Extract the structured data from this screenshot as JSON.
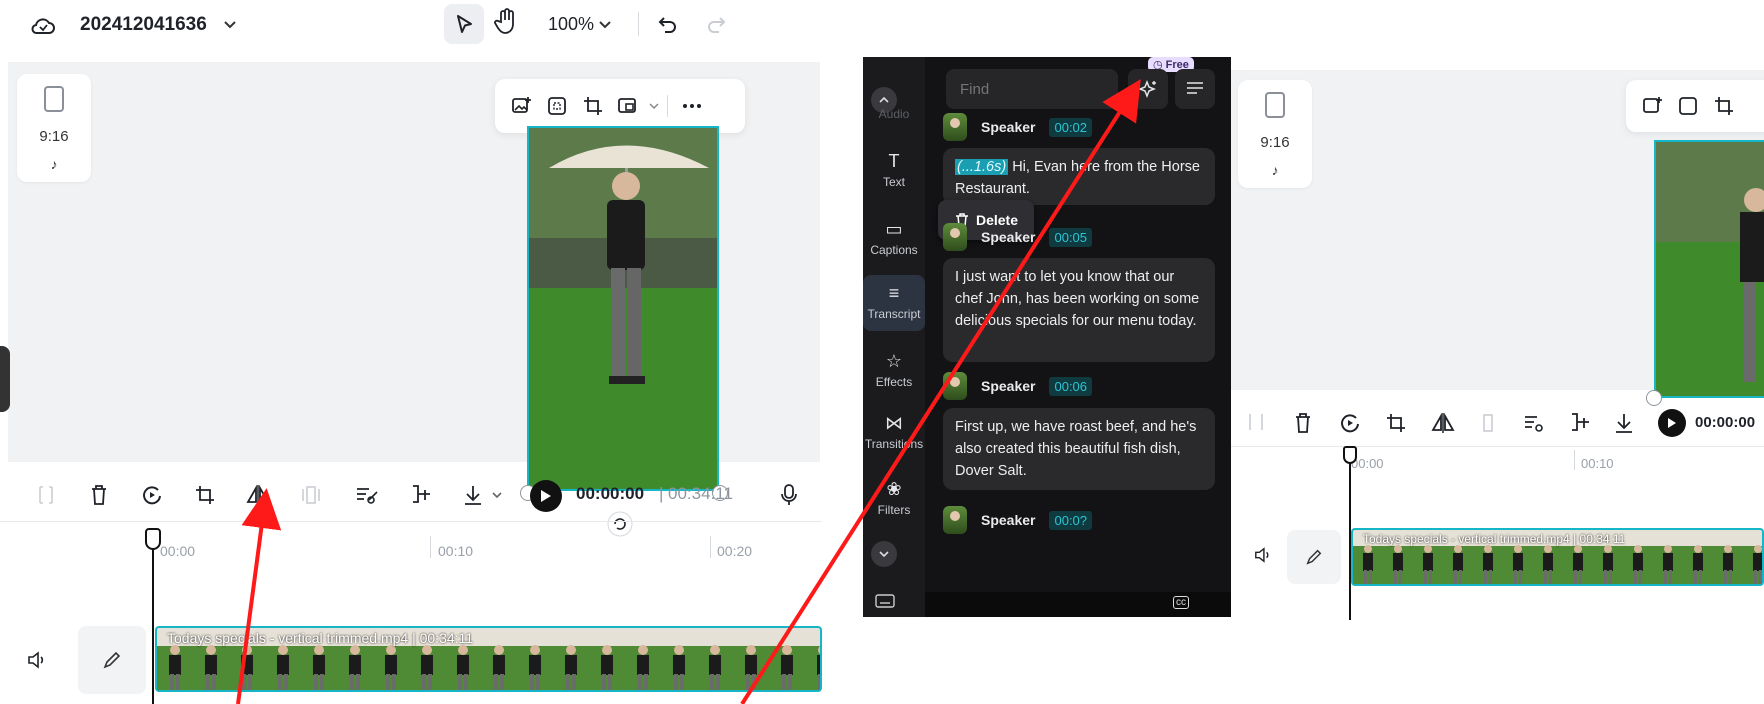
{
  "left_editor": {
    "project_name": "202412041636",
    "zoom": "100%",
    "ratio": "9:16",
    "playhead_time": "00:00:00",
    "separator": "|",
    "duration": "00:34:11",
    "ruler": [
      "00:00",
      "00:10",
      "00:20"
    ],
    "clip_label": "Todays specials - vertical trimmed.mp4 | 00:34:11"
  },
  "transcript_panel": {
    "find_placeholder": "Find",
    "free_badge": "Free",
    "delete_label": "Delete",
    "rail": [
      {
        "label": "Audio",
        "icon": "audio-icon"
      },
      {
        "label": "Text",
        "icon": "text-icon"
      },
      {
        "label": "Captions",
        "icon": "captions-icon"
      },
      {
        "label": "Transcript",
        "icon": "transcript-icon"
      },
      {
        "label": "Effects",
        "icon": "effects-icon"
      },
      {
        "label": "Transitions",
        "icon": "transitions-icon"
      },
      {
        "label": "Filters",
        "icon": "filters-icon"
      }
    ],
    "entries": [
      {
        "speaker": "Speaker",
        "time": "00:02",
        "gap": "(...1.6s)",
        "text": "Hi, Evan here from the Horse Restaurant."
      },
      {
        "speaker": "Speaker",
        "time": "00:05",
        "text": "I just want to let you know that our chef John, has been working on some delicious specials for our menu today."
      },
      {
        "speaker": "Speaker",
        "time": "00:06",
        "text": "First up, we have roast beef, and he's also created this beautiful fish dish, Dover Salt."
      },
      {
        "speaker": "Speaker",
        "time": "00:0?"
      }
    ]
  },
  "right_editor": {
    "ratio": "9:16",
    "playhead_time": "00:00:00",
    "ruler": [
      "00:00",
      "00:10"
    ],
    "clip_label": "Todays specials - vertical trimmed.mp4 | 00:34:11"
  },
  "colors": {
    "accent": "#17b6c6",
    "arrow": "#ff1a1a",
    "panel_bg": "#131315"
  }
}
